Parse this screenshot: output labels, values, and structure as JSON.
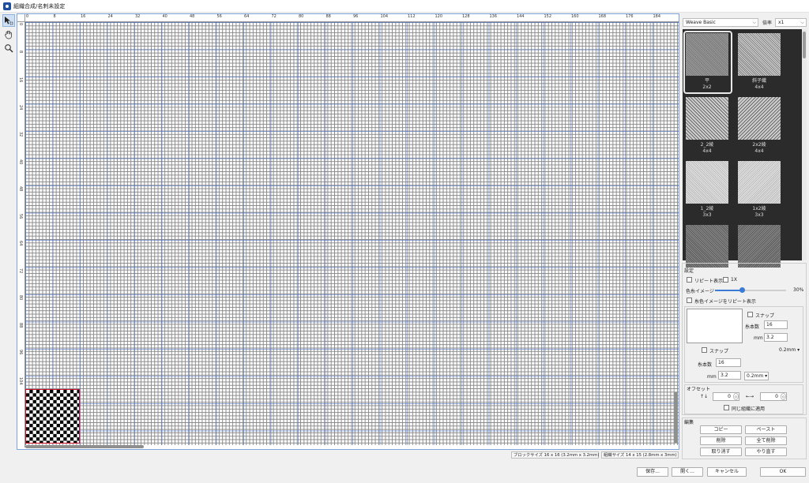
{
  "window": {
    "title": "組織合成/名刺未設定"
  },
  "tools": [
    {
      "name": "select-tool",
      "icon": "arrow-select-icon"
    },
    {
      "name": "hand-tool",
      "icon": "hand-icon"
    },
    {
      "name": "zoom-tool",
      "icon": "magnifier-icon"
    }
  ],
  "ruler": {
    "top": [
      "0",
      "8",
      "16",
      "24",
      "32",
      "40",
      "48",
      "56",
      "64",
      "72",
      "80",
      "88",
      "96",
      "104",
      "112",
      "120",
      "128",
      "136",
      "144",
      "152",
      "160",
      "168",
      "176",
      "184",
      "192",
      "200"
    ],
    "left": [
      "0",
      "8",
      "16",
      "24",
      "32",
      "40",
      "48",
      "56",
      "64",
      "72",
      "80",
      "88",
      "96",
      "104"
    ]
  },
  "status": {
    "block_size": "ブロックサイズ 16 x 16 (3.2mm x 3.2mm)",
    "weave_size": "組織サイズ 14 x 15 (2.8mm x 3mm)"
  },
  "library": {
    "selected": "Weave Basic",
    "zoom_label": "倍率",
    "zoom_value": "x1"
  },
  "weaves": [
    {
      "name": "平",
      "size": "2x2"
    },
    {
      "name": "斜子織",
      "size": "4x4"
    },
    {
      "name": "2_2綾",
      "size": "4x4"
    },
    {
      "name": "2x2綾",
      "size": "4x4"
    },
    {
      "name": "1_2綾",
      "size": "3x3"
    },
    {
      "name": "1x2綾",
      "size": "3x3"
    },
    {
      "name": "",
      "size": ""
    },
    {
      "name": "",
      "size": ""
    }
  ],
  "settings": {
    "title": "設定",
    "repeat_display": "リピート表示",
    "one_x": "1X",
    "thread_image": "色糸イメージ",
    "thread_image_percent": "30%",
    "thread_image_fraction": 0.38,
    "thread_repeat": "糸色イメージをリピート表示",
    "snap_top": "スナップ",
    "count_label_top": "糸本数",
    "count_value_top": "16",
    "mm_label_top": "mm",
    "mm_value_top": "3.2",
    "snap_bottom": "スナップ",
    "unit_select_top": "0.2mm",
    "count_label_bottom": "糸本数",
    "count_value_bottom": "16",
    "mm_label_bottom": "mm",
    "mm_value_bottom": "3.2",
    "unit_select_bottom": "0.2mm"
  },
  "offset": {
    "title": "オフセット",
    "vertical_icon": "↑↓",
    "vertical_value": "0",
    "horizontal_icon": "←→",
    "horizontal_value": "0",
    "apply_same": "同じ組織に適用"
  },
  "edit": {
    "title": "編集",
    "copy": "コピー",
    "paste": "ペースト",
    "delete": "削除",
    "delete_all": "全て削除",
    "undo": "取り消す",
    "redo": "やり直す"
  },
  "footer": {
    "save": "保存...",
    "open": "開く...",
    "cancel": "キャンセル",
    "ok": "OK"
  },
  "colors": {
    "accent": "#3a7bd5",
    "selection_border": "#c8102e",
    "gallery_bg": "#2b2b2b"
  }
}
